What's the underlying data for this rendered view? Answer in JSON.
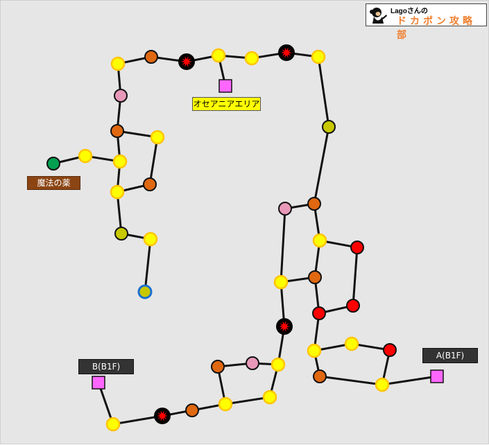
{
  "logo": {
    "line1": "Lagoさんの",
    "line2": "ドカポン攻略部",
    "icon": "monkey-mascot-icon"
  },
  "labels": {
    "oceania": "オセアニアエリア",
    "magic_medicine": "魔法の薬",
    "b_b1f": "B(B1F)",
    "a_b1f": "A(B1F)"
  },
  "legend_colors": {
    "yellow_space": "#ffff00",
    "orange_space": "#e06810",
    "pink_space": "#e898b8",
    "red_space": "#ff0000",
    "olive_space": "#c8c800",
    "green_space": "#00a050",
    "black_burst_space": "#000000",
    "exit_square": "#ff66ff",
    "start_space": "#c8c800"
  }
}
